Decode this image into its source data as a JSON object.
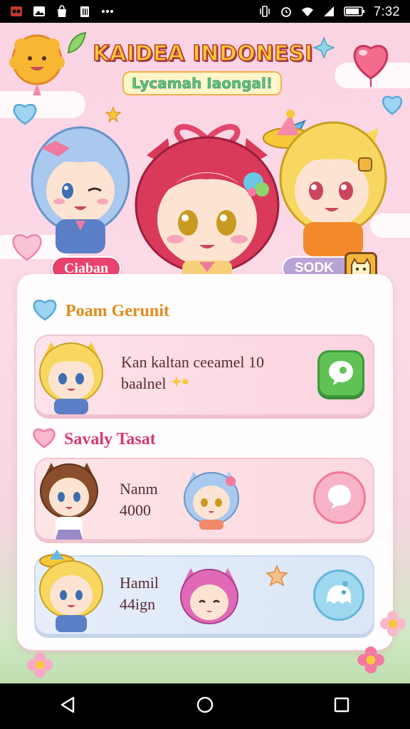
{
  "status_bar": {
    "time": "7:32",
    "left_icons": [
      "app-icon",
      "image-icon",
      "bag-icon",
      "clipboard-icon",
      "more-dots-icon"
    ],
    "right_icons": [
      "vibrate-icon",
      "alarm-icon",
      "wifi-icon",
      "signal-icon",
      "battery-icon"
    ]
  },
  "header": {
    "title": "KAIDEA INDONESI",
    "subtitle": "Lycamah Iaongal!"
  },
  "pills": {
    "left": "Ciaban",
    "right": "SODK"
  },
  "sections": [
    {
      "heading": "Poam Gerunit",
      "icon": "heart-icon",
      "cards": [
        {
          "line1": "Kan kaltan ceeamel 10",
          "line2": "baalnel",
          "action_icon": "chat-bubble-icon"
        }
      ]
    },
    {
      "heading": "Savaly Tasat",
      "icon": "heart-icon",
      "cards": [
        {
          "line1": "Nanm",
          "line2": "4000",
          "action_icon": "speech-bubble-icon"
        },
        {
          "line1": "Hamil",
          "line2": "44ign",
          "action_icon": "ghost-bubble-icon"
        }
      ]
    }
  ],
  "colors": {
    "accent_pink": "#e8426d",
    "accent_green": "#5fc255",
    "panel_bg": "#fffdfd",
    "heading_orange": "#e38a1c",
    "heading_pink": "#d8396c"
  },
  "nav_bar": {
    "buttons": [
      "back-icon",
      "home-icon",
      "recents-icon"
    ]
  }
}
